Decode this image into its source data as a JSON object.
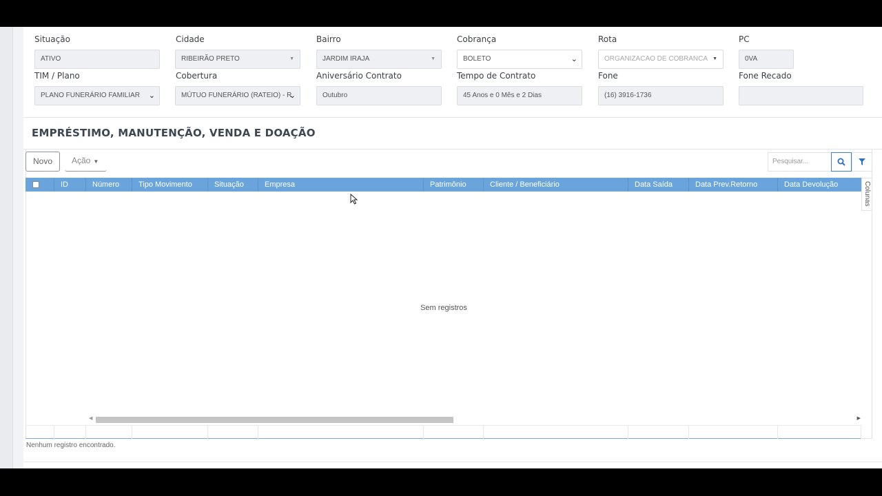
{
  "form": {
    "situacao": {
      "label": "Situação",
      "value": "ATIVO"
    },
    "cidade": {
      "label": "Cidade",
      "value": "RIBEIRÃO PRETO"
    },
    "bairro": {
      "label": "Bairro",
      "value": "JARDIM IRAJA"
    },
    "cobranca": {
      "label": "Cobrança",
      "value": "BOLETO"
    },
    "rota": {
      "label": "Rota",
      "value": "ORGANIZACAO DE COBRANCA"
    },
    "pc": {
      "label": "PC",
      "value": "0VA"
    },
    "tim_plano": {
      "label": "TIM / Plano",
      "value": "PLANO FUNERÁRIO FAMILIAR"
    },
    "cobertura": {
      "label": "Cobertura",
      "value": "MÚTUO FUNERÁRIO (RATEIO) - R"
    },
    "aniversario": {
      "label": "Aniversário Contrato",
      "value": "Outubro"
    },
    "tempo": {
      "label": "Tempo de Contrato",
      "value": "45 Anos e 0 Mês e 2 Dias"
    },
    "fone": {
      "label": "Fone",
      "value": "(16) 3916-1736"
    },
    "fone_recado": {
      "label": "Fone Recado",
      "value": ""
    }
  },
  "section": {
    "title": "EMPRÉSTIMO, MANUTENÇÃO, VENDA E DOAÇÃO"
  },
  "toolbar": {
    "novo_label": "Novo",
    "acao_label": "Ação",
    "search_placeholder": "Pesquisar..."
  },
  "grid": {
    "columns": [
      "ID",
      "Número",
      "Tipo Movimento",
      "Situação",
      "Empresa",
      "Patrimônio",
      "Cliente / Beneficiário",
      "Data Saída",
      "Data Prev.Retorno",
      "Data Devolução"
    ],
    "colunas_tab": "Colunas",
    "empty_message": "Sem registros",
    "status": "Nenhum registro encontrado."
  },
  "icons": {
    "search": "search-icon",
    "filter": "filter-icon",
    "cursor": "mouse-pointer-icon"
  },
  "colors": {
    "header_blue": "#6aa4dc",
    "accent_blue": "#2c6fc2"
  }
}
